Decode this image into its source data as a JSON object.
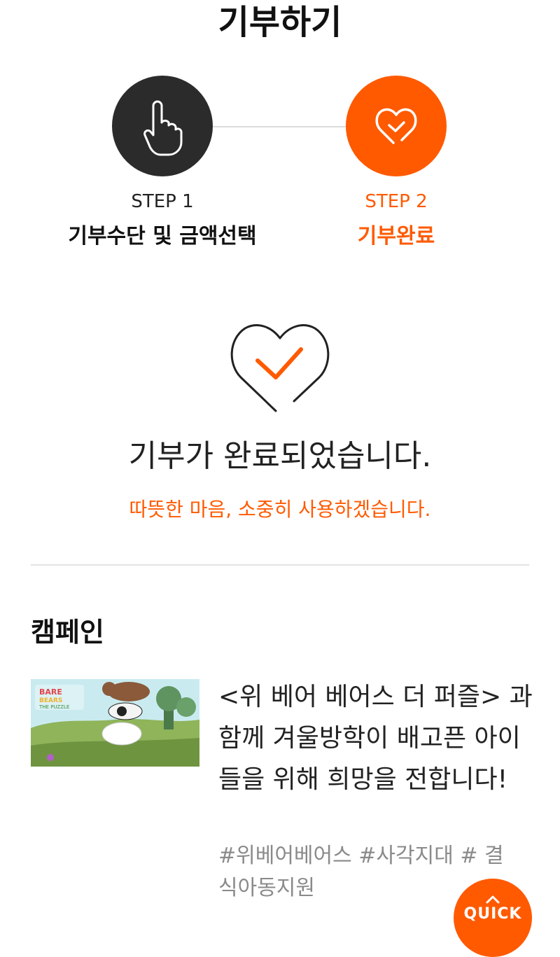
{
  "header": {
    "title": "기부하기"
  },
  "steps": [
    {
      "label": "STEP 1",
      "name": "기부수단 및 금액선택",
      "icon": "pointing-hand-icon"
    },
    {
      "label": "STEP 2",
      "name": "기부완료",
      "icon": "heart-check-icon"
    }
  ],
  "completion": {
    "icon": "heart-check-icon",
    "title": "기부가 완료되었습니다.",
    "subtitle": "따뜻한 마음, 소중히 사용하겠습니다."
  },
  "campaign": {
    "heading": "캠페인",
    "thumbnail_text": "BARE BEARS THE PUZZLE",
    "title": "<위 베어 베어스 더 퍼즐> 과 함께 겨울방학이 배고픈 아이들을 위해 희망을 전합니다!",
    "tags": "#위베어베어스 #사각지대 # 결식아동지원"
  },
  "quick_button": {
    "label": "QUICK",
    "icon": "chevron-up-icon"
  },
  "colors": {
    "accent": "#ff5a00",
    "dark": "#2b2b2b",
    "divider": "#e2e2e2",
    "tag": "#8a8a8a"
  }
}
